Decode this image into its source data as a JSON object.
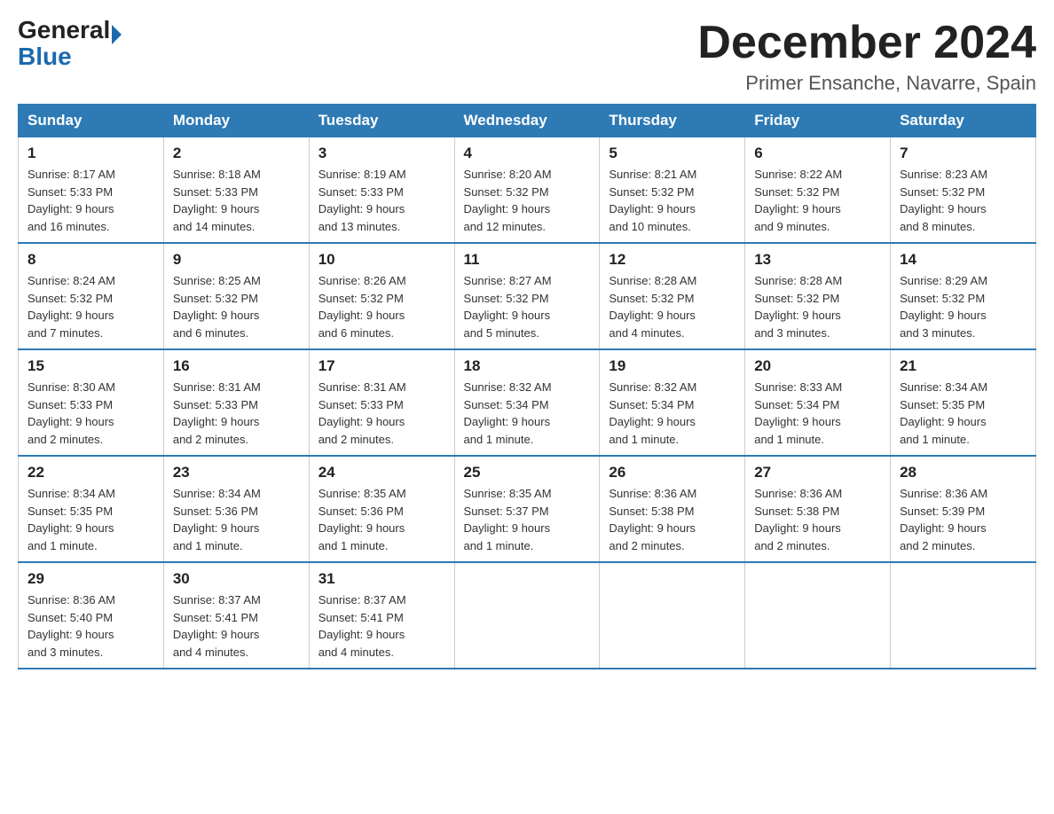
{
  "logo": {
    "general": "General",
    "blue": "Blue"
  },
  "title": "December 2024",
  "subtitle": "Primer Ensanche, Navarre, Spain",
  "days_of_week": [
    "Sunday",
    "Monday",
    "Tuesday",
    "Wednesday",
    "Thursday",
    "Friday",
    "Saturday"
  ],
  "weeks": [
    [
      {
        "day": "1",
        "sunrise": "8:17 AM",
        "sunset": "5:33 PM",
        "daylight": "9 hours and 16 minutes."
      },
      {
        "day": "2",
        "sunrise": "8:18 AM",
        "sunset": "5:33 PM",
        "daylight": "9 hours and 14 minutes."
      },
      {
        "day": "3",
        "sunrise": "8:19 AM",
        "sunset": "5:33 PM",
        "daylight": "9 hours and 13 minutes."
      },
      {
        "day": "4",
        "sunrise": "8:20 AM",
        "sunset": "5:32 PM",
        "daylight": "9 hours and 12 minutes."
      },
      {
        "day": "5",
        "sunrise": "8:21 AM",
        "sunset": "5:32 PM",
        "daylight": "9 hours and 10 minutes."
      },
      {
        "day": "6",
        "sunrise": "8:22 AM",
        "sunset": "5:32 PM",
        "daylight": "9 hours and 9 minutes."
      },
      {
        "day": "7",
        "sunrise": "8:23 AM",
        "sunset": "5:32 PM",
        "daylight": "9 hours and 8 minutes."
      }
    ],
    [
      {
        "day": "8",
        "sunrise": "8:24 AM",
        "sunset": "5:32 PM",
        "daylight": "9 hours and 7 minutes."
      },
      {
        "day": "9",
        "sunrise": "8:25 AM",
        "sunset": "5:32 PM",
        "daylight": "9 hours and 6 minutes."
      },
      {
        "day": "10",
        "sunrise": "8:26 AM",
        "sunset": "5:32 PM",
        "daylight": "9 hours and 6 minutes."
      },
      {
        "day": "11",
        "sunrise": "8:27 AM",
        "sunset": "5:32 PM",
        "daylight": "9 hours and 5 minutes."
      },
      {
        "day": "12",
        "sunrise": "8:28 AM",
        "sunset": "5:32 PM",
        "daylight": "9 hours and 4 minutes."
      },
      {
        "day": "13",
        "sunrise": "8:28 AM",
        "sunset": "5:32 PM",
        "daylight": "9 hours and 3 minutes."
      },
      {
        "day": "14",
        "sunrise": "8:29 AM",
        "sunset": "5:32 PM",
        "daylight": "9 hours and 3 minutes."
      }
    ],
    [
      {
        "day": "15",
        "sunrise": "8:30 AM",
        "sunset": "5:33 PM",
        "daylight": "9 hours and 2 minutes."
      },
      {
        "day": "16",
        "sunrise": "8:31 AM",
        "sunset": "5:33 PM",
        "daylight": "9 hours and 2 minutes."
      },
      {
        "day": "17",
        "sunrise": "8:31 AM",
        "sunset": "5:33 PM",
        "daylight": "9 hours and 2 minutes."
      },
      {
        "day": "18",
        "sunrise": "8:32 AM",
        "sunset": "5:34 PM",
        "daylight": "9 hours and 1 minute."
      },
      {
        "day": "19",
        "sunrise": "8:32 AM",
        "sunset": "5:34 PM",
        "daylight": "9 hours and 1 minute."
      },
      {
        "day": "20",
        "sunrise": "8:33 AM",
        "sunset": "5:34 PM",
        "daylight": "9 hours and 1 minute."
      },
      {
        "day": "21",
        "sunrise": "8:34 AM",
        "sunset": "5:35 PM",
        "daylight": "9 hours and 1 minute."
      }
    ],
    [
      {
        "day": "22",
        "sunrise": "8:34 AM",
        "sunset": "5:35 PM",
        "daylight": "9 hours and 1 minute."
      },
      {
        "day": "23",
        "sunrise": "8:34 AM",
        "sunset": "5:36 PM",
        "daylight": "9 hours and 1 minute."
      },
      {
        "day": "24",
        "sunrise": "8:35 AM",
        "sunset": "5:36 PM",
        "daylight": "9 hours and 1 minute."
      },
      {
        "day": "25",
        "sunrise": "8:35 AM",
        "sunset": "5:37 PM",
        "daylight": "9 hours and 1 minute."
      },
      {
        "day": "26",
        "sunrise": "8:36 AM",
        "sunset": "5:38 PM",
        "daylight": "9 hours and 2 minutes."
      },
      {
        "day": "27",
        "sunrise": "8:36 AM",
        "sunset": "5:38 PM",
        "daylight": "9 hours and 2 minutes."
      },
      {
        "day": "28",
        "sunrise": "8:36 AM",
        "sunset": "5:39 PM",
        "daylight": "9 hours and 2 minutes."
      }
    ],
    [
      {
        "day": "29",
        "sunrise": "8:36 AM",
        "sunset": "5:40 PM",
        "daylight": "9 hours and 3 minutes."
      },
      {
        "day": "30",
        "sunrise": "8:37 AM",
        "sunset": "5:41 PM",
        "daylight": "9 hours and 4 minutes."
      },
      {
        "day": "31",
        "sunrise": "8:37 AM",
        "sunset": "5:41 PM",
        "daylight": "9 hours and 4 minutes."
      },
      null,
      null,
      null,
      null
    ]
  ],
  "labels": {
    "sunrise": "Sunrise:",
    "sunset": "Sunset:",
    "daylight": "Daylight:"
  }
}
